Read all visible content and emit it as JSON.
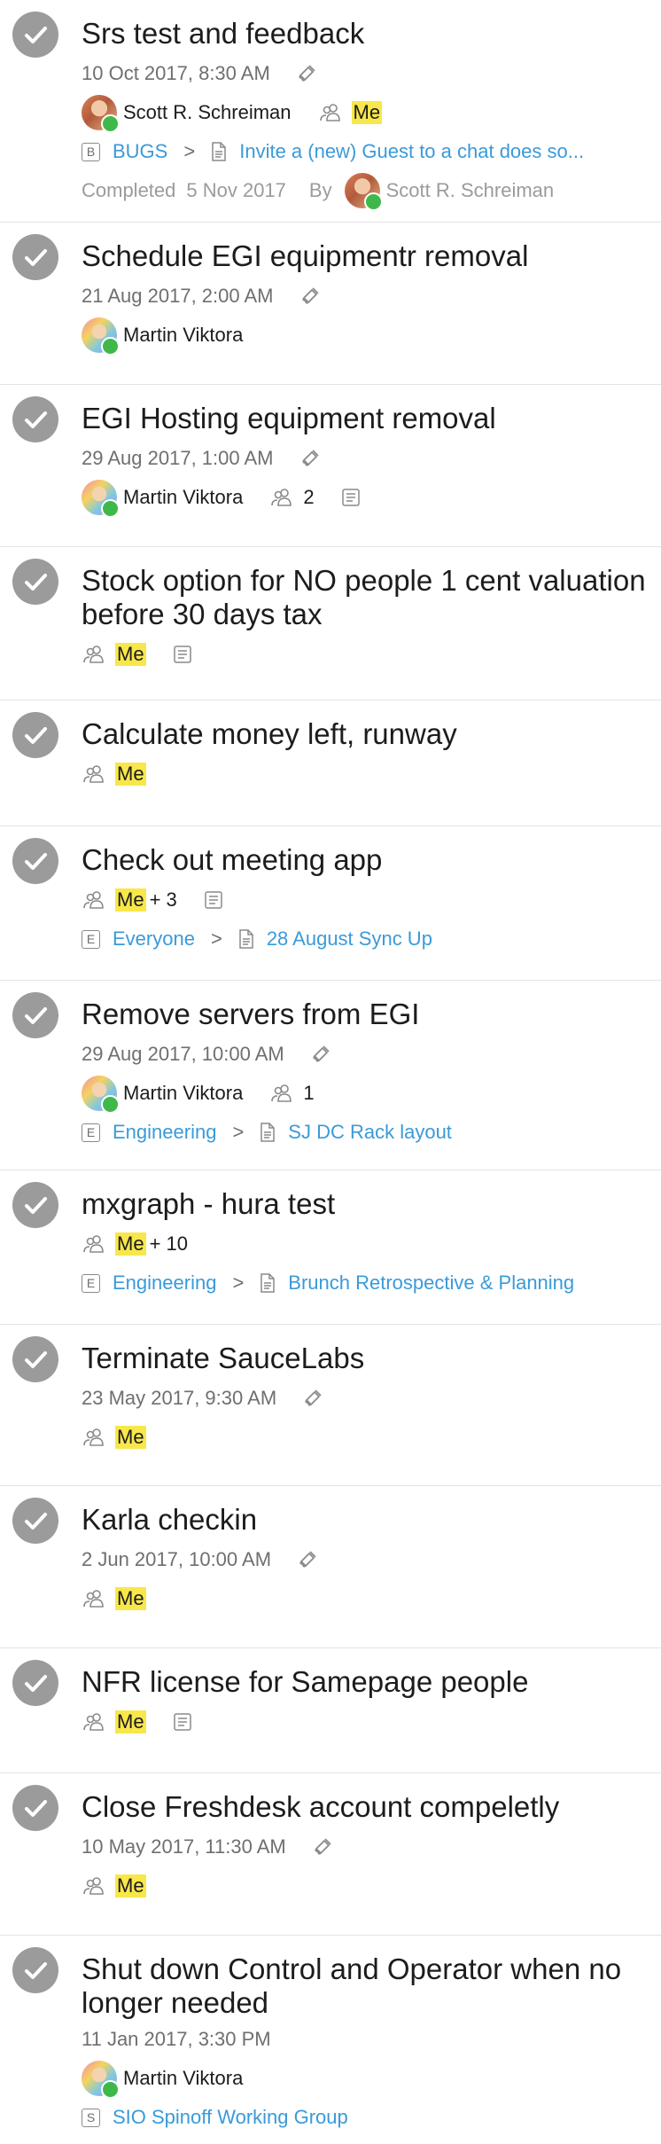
{
  "tasks": [
    {
      "title": "Srs test and feedback",
      "date": "10 Oct 2017, 8:30 AM",
      "owner": "Scott R. Schreiman",
      "assignee": "Me",
      "breadcrumb": {
        "badge": "B",
        "space": "BUGS",
        "separator": ">",
        "page": "Invite a (new) Guest to a chat does so..."
      },
      "completed": {
        "label": "Completed",
        "date": "5 Nov 2017",
        "by": "By",
        "name": "Scott R. Schreiman"
      }
    },
    {
      "title": "Schedule EGI equipmentr removal",
      "date": "21 Aug 2017, 2:00 AM",
      "owner": "Martin Viktora"
    },
    {
      "title": "EGI Hosting equipment removal",
      "date": "29 Aug 2017, 1:00 AM",
      "owner": "Martin Viktora",
      "assignee_count": "2"
    },
    {
      "title": "Stock option for NO people 1 cent valuation before 30 days tax",
      "assignee": "Me"
    },
    {
      "title": "Calculate money left, runway",
      "assignee": "Me"
    },
    {
      "title": "Check out meeting app",
      "assignee": "Me",
      "extra": "+ 3",
      "breadcrumb": {
        "badge": "E",
        "space": "Everyone",
        "separator": ">",
        "page": "28 August Sync Up"
      }
    },
    {
      "title": "Remove servers from EGI",
      "date": "29 Aug 2017, 10:00 AM",
      "owner": "Martin Viktora",
      "assignee_count": "1",
      "breadcrumb": {
        "badge": "E",
        "space": "Engineering",
        "separator": ">",
        "page": "SJ DC Rack layout"
      }
    },
    {
      "title": "mxgraph - hura test",
      "assignee": "Me",
      "extra": "+ 10",
      "breadcrumb": {
        "badge": "E",
        "space": "Engineering",
        "separator": ">",
        "page": "Brunch Retrospective & Planning"
      }
    },
    {
      "title": "Terminate SauceLabs",
      "date": "23 May 2017, 9:30 AM",
      "assignee": "Me"
    },
    {
      "title": "Karla checkin",
      "date": "2 Jun 2017, 10:00 AM",
      "assignee": "Me"
    },
    {
      "title": "NFR license for Samepage people",
      "assignee": "Me"
    },
    {
      "title": "Close Freshdesk account compeletly",
      "date": "10 May 2017, 11:30 AM",
      "assignee": "Me"
    },
    {
      "title": "Shut down Control and Operator when no longer needed",
      "date": "11 Jan 2017, 3:30 PM",
      "owner": "Martin Viktora",
      "breadcrumb": {
        "badge": "S",
        "space": "SIO Spinoff Working Group"
      }
    }
  ],
  "colors": {
    "check": "#9b9b9b",
    "highlight": "#f8e74a",
    "link": "#3a9ad9",
    "online": "#3fb84a"
  },
  "icons": [
    "check-icon",
    "bell-icon",
    "assignees-icon",
    "note-icon",
    "document-icon"
  ]
}
